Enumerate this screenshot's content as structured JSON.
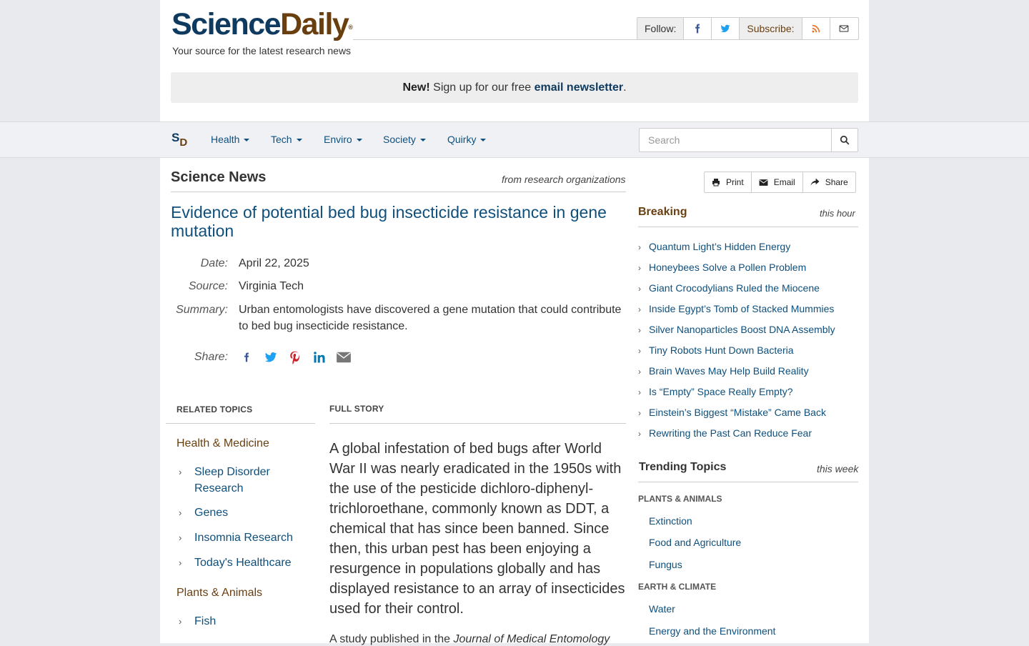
{
  "header": {
    "logo_science": "Science",
    "logo_daily": "Daily",
    "logo_reg": "®",
    "tagline": "Your source for the latest research news",
    "follow_label": "Follow:",
    "subscribe_label": "Subscribe:"
  },
  "newsletter": {
    "new_label": "New!",
    "text": " Sign up for our free ",
    "link": "email newsletter",
    "end": "."
  },
  "nav": {
    "logo_s": "S",
    "logo_d": "D",
    "items": [
      "Health",
      "Tech",
      "Enviro",
      "Society",
      "Quirky"
    ],
    "search_placeholder": "Search"
  },
  "article": {
    "section_title": "Science News",
    "section_sub": "from research organizations",
    "headline": "Evidence of potential bed bug insecticide resistance in gene mutation",
    "date_label": "Date:",
    "date": "April 22, 2025",
    "source_label": "Source:",
    "source": "Virginia Tech",
    "summary_label": "Summary:",
    "summary": "Urban entomologists have discovered a gene mutation that could contribute to bed bug insecticide resistance.",
    "share_label": "Share:",
    "full_story_label": "FULL STORY",
    "story_p1": "A global infestation of bed bugs after World War II was nearly eradicated in the 1950s with the use of the pesticide dichloro-diphenyl-trichloroethane, commonly known as DDT, a chemical that has since been banned. Since then, this urban pest has been enjoying a resurgence in populations globally and has displayed resistance to an array of insecticides used for their control.",
    "story_p2_start": "A study published in the ",
    "story_p2_journal": "Journal of Medical Entomology"
  },
  "related": {
    "heading": "RELATED TOPICS",
    "cat1": "Health & Medicine",
    "cat1_items": [
      "Sleep Disorder Research",
      "Genes",
      "Insomnia Research",
      "Today's Healthcare"
    ],
    "cat2": "Plants & Animals",
    "cat2_items": [
      "Fish"
    ]
  },
  "tools": {
    "print": "Print",
    "email": "Email",
    "share": "Share"
  },
  "breaking": {
    "title": "Breaking",
    "sub": "this hour",
    "items": [
      "Quantum Light’s Hidden Energy",
      "Honeybees Solve a Pollen Problem",
      "Giant Crocodylians Ruled the Miocene",
      "Inside Egypt’s Tomb of Stacked Mummies",
      "Silver Nanoparticles Boost DNA Assembly",
      "Tiny Robots Hunt Down Bacteria",
      "Brain Waves May Help Build Reality",
      "Is “Empty” Space Really Empty?",
      "Einstein’s Biggest “Mistake” Came Back",
      "Rewriting the Past Can Reduce Fear"
    ]
  },
  "trending": {
    "title": "Trending Topics",
    "sub": "this week",
    "cat1": "PLANTS & ANIMALS",
    "cat1_items": [
      "Extinction",
      "Food and Agriculture",
      "Fungus"
    ],
    "cat2": "EARTH & CLIMATE",
    "cat2_items": [
      "Water",
      "Energy and the Environment"
    ]
  },
  "colors": {
    "brand_navy": "#0e3a5f",
    "brand_brown": "#6a3f10",
    "link_blue": "#0e4f7c"
  }
}
